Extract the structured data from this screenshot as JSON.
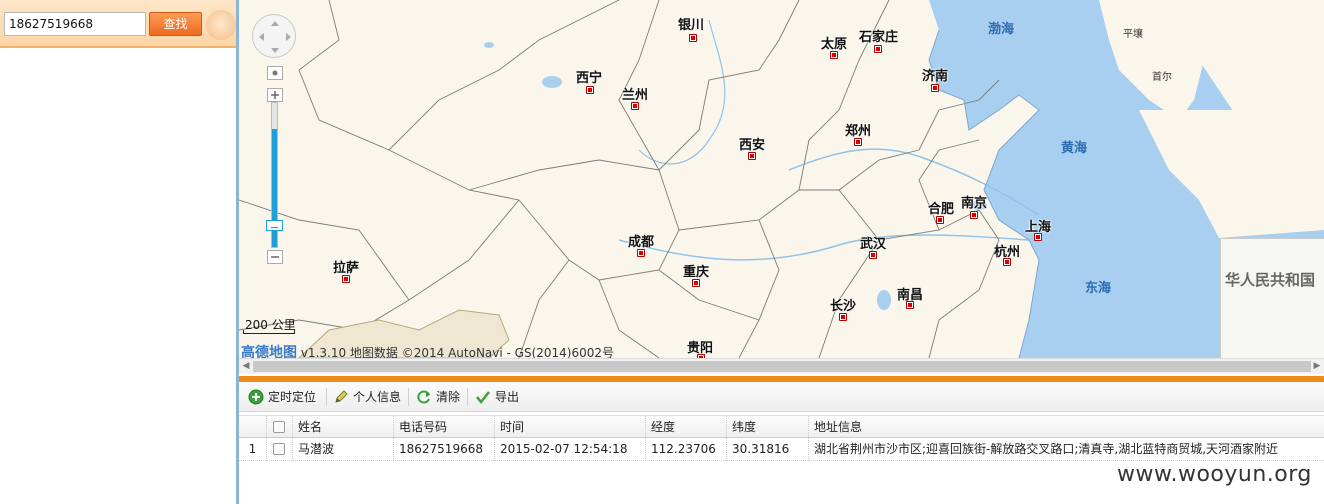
{
  "search": {
    "value": "18627519668",
    "button_label": "查找"
  },
  "map": {
    "cities": [
      {
        "name": "银川"
      },
      {
        "name": "太原"
      },
      {
        "name": "石家庄"
      },
      {
        "name": "西宁"
      },
      {
        "name": "兰州"
      },
      {
        "name": "济南"
      },
      {
        "name": "西安"
      },
      {
        "name": "郑州"
      },
      {
        "name": "合肥"
      },
      {
        "name": "南京"
      },
      {
        "name": "上海"
      },
      {
        "name": "成都"
      },
      {
        "name": "武汉"
      },
      {
        "name": "杭州"
      },
      {
        "name": "拉萨"
      },
      {
        "name": "重庆"
      },
      {
        "name": "长沙"
      },
      {
        "name": "南昌"
      },
      {
        "name": "贵阳"
      }
    ],
    "seas": [
      "渤海",
      "黄海",
      "东海"
    ],
    "small_cities": [
      "平壤",
      "首尔"
    ],
    "inset_label": "华人民共和国",
    "scale_label": "200 公里",
    "attribution_brand": "高德地图",
    "attribution_text": "v1.3.10 地图数据 ©2014 AutoNavi - GS(2014)6002号"
  },
  "toolbar": {
    "locate_label": "定时定位",
    "info_label": "个人信息",
    "clear_label": "清除",
    "export_label": "导出"
  },
  "grid": {
    "headers": [
      "姓名",
      "电话号码",
      "时间",
      "经度",
      "纬度",
      "地址信息"
    ],
    "rows": [
      {
        "index": "1",
        "name": "马潜波",
        "phone": "18627519668",
        "time": "2015-02-07 12:54:18",
        "longitude": "112.23706",
        "latitude": "30.31816",
        "address": "湖北省荆州市沙市区;迎喜回族街-解放路交叉路口;清真寺,湖北蓝特商贸城,天河酒家附近"
      }
    ]
  },
  "watermark": "www.wooyun.org",
  "colors": {
    "accent_orange": "#f18a1c",
    "sea_blue": "#a9cff0",
    "zoom_blue": "#1f9fd8",
    "city_marker_red": "#d80000"
  }
}
